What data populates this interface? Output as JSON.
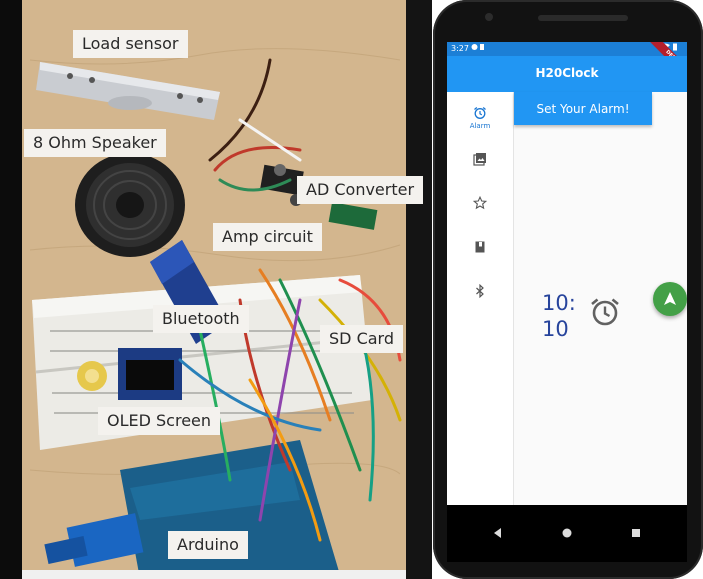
{
  "photo": {
    "callouts": {
      "load_sensor": "Load sensor",
      "speaker": "8 Ohm Speaker",
      "ad_converter": "AD Converter",
      "amp_circuit": "Amp circuit",
      "bluetooth": "Bluetooth",
      "sd_card": "SD Card",
      "oled_screen": "OLED Screen",
      "arduino": "Arduino"
    }
  },
  "phone": {
    "status_bar": {
      "time": "3:27",
      "debug_banner": "DEBUG"
    },
    "app_bar": {
      "title": "H20Clock"
    },
    "nav_rail": {
      "items": [
        {
          "icon": "alarm-icon",
          "label": "Alarm",
          "active": true
        },
        {
          "icon": "photo-library-icon",
          "active": false
        },
        {
          "icon": "star-outline-icon",
          "active": false
        },
        {
          "icon": "book-icon",
          "active": false
        },
        {
          "icon": "bluetooth-icon",
          "active": false
        }
      ]
    },
    "content": {
      "set_alarm_button": "Set Your Alarm!",
      "clock_hours": "10:",
      "clock_minutes": "10"
    },
    "fab_icon": "navigation-arrow-icon",
    "system_nav": [
      "back-icon",
      "home-icon",
      "recents-icon"
    ],
    "colors": {
      "primary": "#2196f3",
      "status_bar": "#1c7fd6",
      "fab": "#43a047",
      "clock_text": "#27449c"
    }
  }
}
